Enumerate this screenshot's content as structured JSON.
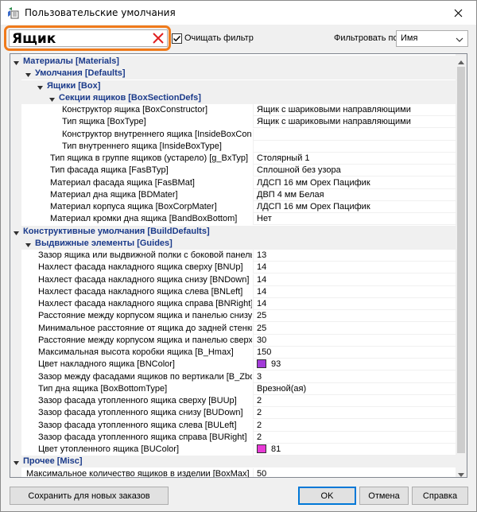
{
  "window": {
    "title": "Пользовательские умолчания"
  },
  "toolbar": {
    "search_value": "Ящик",
    "clear_filter_label": "Очищать фильтр",
    "filter_by_label": "Фильтровать по:",
    "filter_by_value": "Имя"
  },
  "grid": {
    "rows": [
      {
        "kind": "cat",
        "level": 0,
        "label": "Материалы [Materials]"
      },
      {
        "kind": "cat",
        "level": 1,
        "label": "Умолчания [Defaults]"
      },
      {
        "kind": "cat",
        "level": 2,
        "label": "Ящики [Box]"
      },
      {
        "kind": "cat",
        "level": 3,
        "label": "Секции ящиков [BoxSectionDefs]"
      },
      {
        "kind": "prop",
        "level": 4,
        "name": "Конструктор ящика [BoxConstructor]",
        "value": "Ящик с шариковыми направляющими"
      },
      {
        "kind": "prop",
        "level": 4,
        "name": "Тип ящика [BoxType]",
        "value": "Ящик с шариковыми направляющими"
      },
      {
        "kind": "prop",
        "level": 4,
        "name": "Конструктор внутреннего ящика [InsideBoxConstru...",
        "value": ""
      },
      {
        "kind": "prop",
        "level": 4,
        "name": "Тип внутреннего ящика [InsideBoxType]",
        "value": ""
      },
      {
        "kind": "prop",
        "level": 3,
        "name": "Тип ящика в группе ящиков (устарело) [g_BxTyp]",
        "value": "Столярный 1"
      },
      {
        "kind": "prop",
        "level": 3,
        "name": "Тип фасада ящика [FasBTyp]",
        "value": "Сплошной без узора"
      },
      {
        "kind": "prop",
        "level": 3,
        "name": "Материал фасада ящика [FasBMat]",
        "value": "ЛДСП 16 мм Орех Пацифик"
      },
      {
        "kind": "prop",
        "level": 3,
        "name": "Материал дна ящика [BDMater]",
        "value": "ДВП 4 мм Белая"
      },
      {
        "kind": "prop",
        "level": 3,
        "name": "Материал корпуса ящика [BoxCorpMater]",
        "value": "ЛДСП 16 мм Орех Пацифик"
      },
      {
        "kind": "prop",
        "level": 3,
        "name": "Материал кромки дна ящика [BandBoxBottom]",
        "value": "Нет"
      },
      {
        "kind": "cat",
        "level": 0,
        "label": "Конструктивные умолчания [BuildDefaults]"
      },
      {
        "kind": "cat",
        "level": 1,
        "label": "Выдвижные элементы [Guides]"
      },
      {
        "kind": "prop",
        "level": 2,
        "name": "Зазор ящика или выдвижной полки с боковой панелью [...",
        "value": "13"
      },
      {
        "kind": "prop",
        "level": 2,
        "name": "Нахлест фасада накладного ящика сверху [BNUp]",
        "value": "14"
      },
      {
        "kind": "prop",
        "level": 2,
        "name": "Нахлест фасада накладного ящика снизу [BNDown]",
        "value": "14"
      },
      {
        "kind": "prop",
        "level": 2,
        "name": "Нахлест фасада накладного ящика слева [BNLeft]",
        "value": "14"
      },
      {
        "kind": "prop",
        "level": 2,
        "name": "Нахлест фасада накладного ящика справа [BNRight]",
        "value": "14"
      },
      {
        "kind": "prop",
        "level": 2,
        "name": "Расстояние между корпусом ящика и панелью снизу [B...",
        "value": "25"
      },
      {
        "kind": "prop",
        "level": 2,
        "name": "Минимальное расстояние от ящика до задней стенки [B...",
        "value": "25"
      },
      {
        "kind": "prop",
        "level": 2,
        "name": "Расстояние между корпусом ящика и панелью сверху [B...",
        "value": "30"
      },
      {
        "kind": "prop",
        "level": 2,
        "name": "Максимальная высота коробки ящика [B_Hmax]",
        "value": "150"
      },
      {
        "kind": "prop",
        "level": 2,
        "name": "Цвет накладного ящика [BNColor]",
        "value": "93",
        "swatch": "#a23bd8"
      },
      {
        "kind": "prop",
        "level": 2,
        "name": "Зазор между фасадами ящиков по вертикали [B_Zbox]",
        "value": "3"
      },
      {
        "kind": "prop",
        "level": 2,
        "name": "Тип дна ящика [BoxBottomType]",
        "value": "Врезной(ая)"
      },
      {
        "kind": "prop",
        "level": 2,
        "name": "Зазор фасада утопленного ящика сверху [BUUp]",
        "value": "2"
      },
      {
        "kind": "prop",
        "level": 2,
        "name": "Зазор фасада утопленного ящика снизу [BUDown]",
        "value": "2"
      },
      {
        "kind": "prop",
        "level": 2,
        "name": "Зазор фасада утопленного ящика слева [BULeft]",
        "value": "2"
      },
      {
        "kind": "prop",
        "level": 2,
        "name": "Зазор фасада утопленного ящика справа [BURight]",
        "value": "2"
      },
      {
        "kind": "prop",
        "level": 2,
        "name": "Цвет утопленного ящика [BUColor]",
        "value": "81",
        "swatch": "#e83ad6"
      },
      {
        "kind": "cat",
        "level": 0,
        "label": "Прочее [Misc]"
      },
      {
        "kind": "prop",
        "level": 1,
        "name": "Максимальное количество ящиков в изделии [BoxMax]",
        "value": "50"
      }
    ]
  },
  "buttons": {
    "save_for_new_orders": "Сохранить для новых заказов",
    "ok": "OK",
    "cancel": "Отмена",
    "help": "Справка"
  },
  "colors": {
    "highlight": "#f07a1a",
    "category_text": "#1a3a8a",
    "clear_icon": "#e02020"
  }
}
